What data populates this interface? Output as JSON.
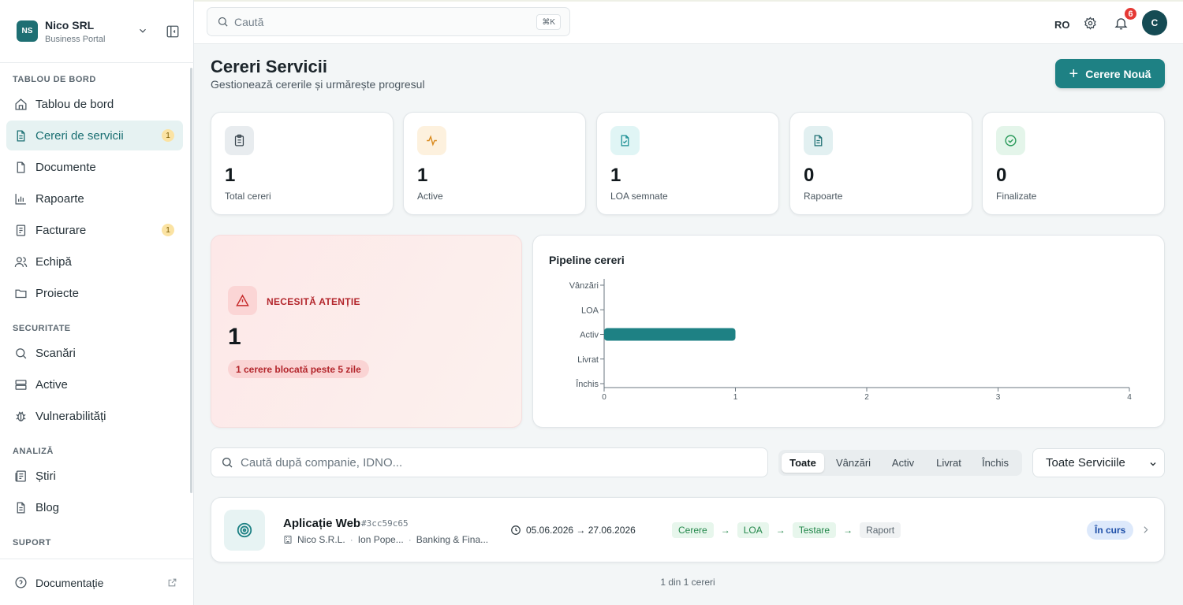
{
  "brand": {
    "logo": "NS",
    "name": "Nico SRL",
    "subtitle": "Business Portal"
  },
  "sidebar": {
    "sections": [
      {
        "title": "TABLOU DE BORD"
      },
      {
        "title": "SECURITATE"
      },
      {
        "title": "ANALIZĂ"
      },
      {
        "title": "SUPORT"
      }
    ],
    "items": [
      {
        "label": "Tablou de bord",
        "icon": "home-icon"
      },
      {
        "label": "Cereri de servicii",
        "icon": "file-icon",
        "badge": "1",
        "active": true
      },
      {
        "label": "Documente",
        "icon": "document-icon"
      },
      {
        "label": "Rapoarte",
        "icon": "bar-chart-icon"
      },
      {
        "label": "Facturare",
        "icon": "invoice-icon",
        "badge": "1"
      },
      {
        "label": "Echipă",
        "icon": "users-icon"
      },
      {
        "label": "Proiecte",
        "icon": "folder-icon"
      },
      {
        "label": "Scanări",
        "icon": "search-icon"
      },
      {
        "label": "Active",
        "icon": "server-icon"
      },
      {
        "label": "Vulnerabilități",
        "icon": "bug-icon"
      },
      {
        "label": "Știri",
        "icon": "newspaper-icon"
      },
      {
        "label": "Blog",
        "icon": "document-icon"
      }
    ],
    "footer": {
      "label": "Documentație",
      "icon": "help-circle-icon"
    }
  },
  "topbar": {
    "search_placeholder": "Caută",
    "shortcut": "⌘K",
    "language": "RO",
    "notifications": "6",
    "avatar": "C"
  },
  "page": {
    "title": "Cereri Servicii",
    "subtitle": "Gestionează cererile și urmărește progresul",
    "new_button": "Cerere Nouă"
  },
  "stats": [
    {
      "value": "1",
      "label": "Total cereri",
      "icon": "clipboard-icon",
      "color": "#e8ecef"
    },
    {
      "value": "1",
      "label": "Active",
      "icon": "activity-icon",
      "color": "#fdf1de"
    },
    {
      "value": "1",
      "label": "LOA semnate",
      "icon": "file-check-icon",
      "color": "#e0f5f5"
    },
    {
      "value": "0",
      "label": "Rapoarte",
      "icon": "file-text-icon",
      "color": "#e2f0f1"
    },
    {
      "value": "0",
      "label": "Finalizate",
      "icon": "check-circle-icon",
      "color": "#e4f5ea"
    }
  ],
  "attention": {
    "title": "NECESITĂ ATENȚIE",
    "value": "1",
    "note": "1 cerere blocată peste 5 zile"
  },
  "chart_data": {
    "type": "bar",
    "orientation": "horizontal",
    "title": "Pipeline cereri",
    "categories": [
      "Vânzări",
      "LOA",
      "Activ",
      "Livrat",
      "Închis"
    ],
    "values": [
      0,
      0,
      1,
      0,
      0
    ],
    "xlim": [
      0,
      4
    ],
    "xticks": [
      "0",
      "1",
      "2",
      "3",
      "4"
    ],
    "color": "#1e8184",
    "grid": false
  },
  "filters": {
    "search_placeholder": "Caută după companie, IDNO...",
    "tabs": [
      "Toate",
      "Vânzări",
      "Activ",
      "Livrat",
      "Închis"
    ],
    "selected_tab": "Toate",
    "service_select": "Toate Serviciile"
  },
  "requests": [
    {
      "name": "Aplicație Web",
      "id": "#3cc59c65",
      "company": "Nico S.R.L.",
      "person": "Ion Pope...",
      "industry": "Banking & Fina...",
      "dates": "05.06.2026 → 27.06.2026",
      "steps": [
        {
          "label": "Cerere",
          "done": true
        },
        {
          "label": "LOA",
          "done": true
        },
        {
          "label": "Testare",
          "done": true
        },
        {
          "label": "Raport",
          "done": false
        }
      ],
      "status": "În curs"
    }
  ],
  "pagination": "1 din 1 cereri"
}
